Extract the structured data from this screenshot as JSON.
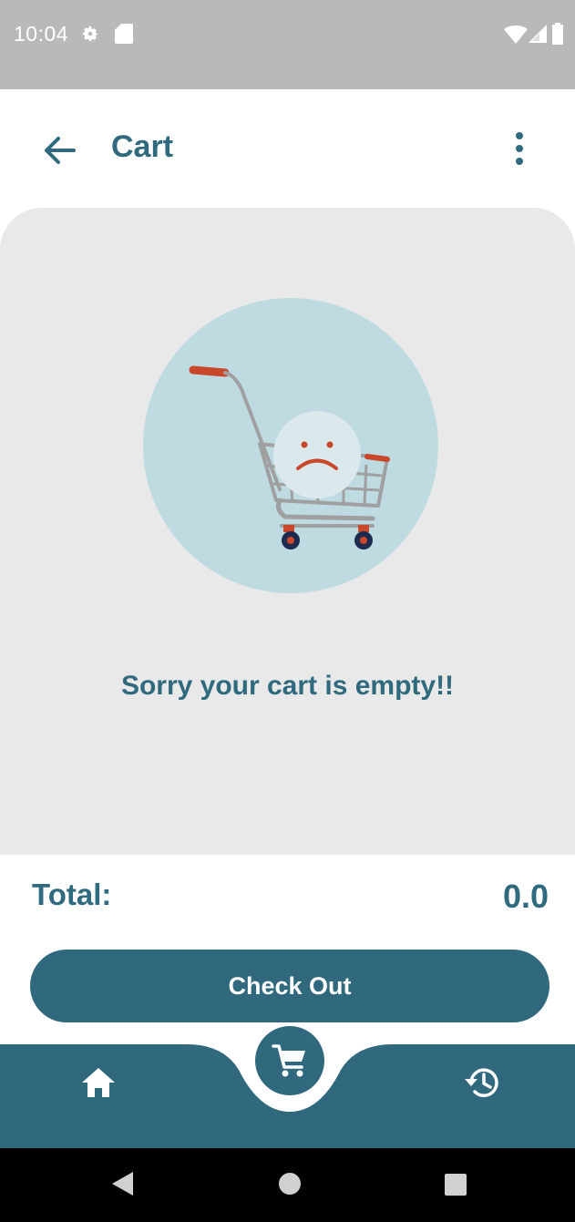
{
  "status_bar": {
    "time": "10:04",
    "icons": [
      "settings-icon",
      "sd-card-icon",
      "wifi-icon",
      "signal-icon",
      "battery-icon"
    ]
  },
  "app_bar": {
    "title": "Cart",
    "back_icon": "arrow-back-icon",
    "menu_icon": "more-vert-icon"
  },
  "empty_state": {
    "illustration": "empty-cart-sad-face",
    "message": "Sorry your cart is empty!!"
  },
  "summary": {
    "total_label": "Total:",
    "total_value": "0.0"
  },
  "checkout": {
    "label": "Check Out"
  },
  "bottom_nav": {
    "items": [
      {
        "icon": "home-icon",
        "active": false
      },
      {
        "icon": "cart-icon",
        "active": true
      },
      {
        "icon": "history-icon",
        "active": false
      }
    ]
  },
  "colors": {
    "primary": "#30697d",
    "background": "#e9e9e9",
    "illustration_circle": "#bfdbe2",
    "accent": "#c9472a"
  }
}
